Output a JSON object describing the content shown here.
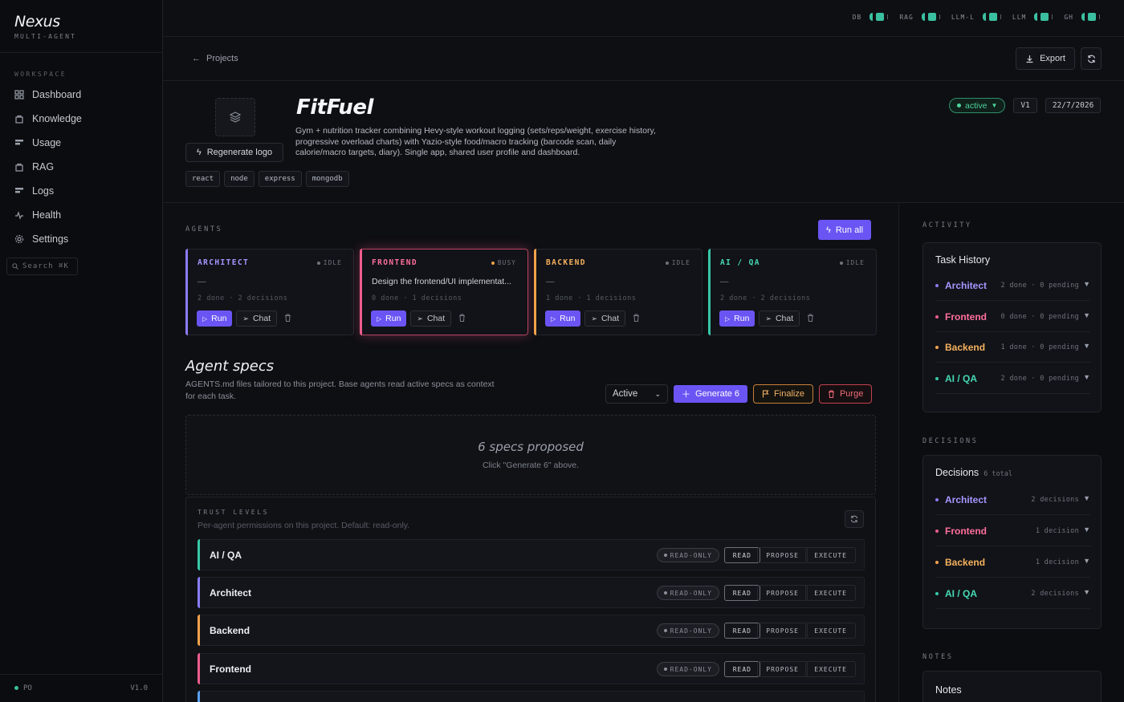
{
  "brand": {
    "name": "Nexus",
    "sub": "MULTI-AGENT"
  },
  "sidebar": {
    "workspace_label": "WORKSPACE",
    "items": [
      {
        "label": "Dashboard"
      },
      {
        "label": "Knowledge"
      },
      {
        "label": "Usage"
      },
      {
        "label": "RAG"
      },
      {
        "label": "Logs"
      },
      {
        "label": "Health"
      },
      {
        "label": "Settings"
      }
    ],
    "search_label": "Search ⌘K",
    "footer_left": "PO",
    "footer_right": "V1.0"
  },
  "status": [
    {
      "label": "DB"
    },
    {
      "label": "RAG"
    },
    {
      "label": "LLM-L"
    },
    {
      "label": "LLM"
    },
    {
      "label": "GH"
    }
  ],
  "breadcrumb": {
    "label": "Projects"
  },
  "toolbar": {
    "export_label": "Export"
  },
  "project": {
    "title": "FitFuel",
    "description": "Gym + nutrition tracker combining Hevy-style workout logging (sets/reps/weight, exercise history, progressive overload charts) with Yazio-style food/macro tracking (barcode scan, daily calorie/macro targets, diary). Single app, shared user profile and dashboard.",
    "regen_label": "Regenerate logo",
    "tags": [
      "react",
      "node",
      "express",
      "mongodb"
    ],
    "status": "active",
    "version": "V1",
    "date": "22/7/2026"
  },
  "agents_section": {
    "label": "AGENTS",
    "run_all": "Run all"
  },
  "agents": [
    {
      "name": "ARCHITECT",
      "state": "IDLE",
      "task": "—",
      "meta": "2 done · 2 decisions",
      "color": "#8a7cf6"
    },
    {
      "name": "FRONTEND",
      "state": "BUSY",
      "task": "Design the frontend/UI implementat...",
      "meta": "0 done · 1 decisions",
      "color": "#ee5d8c"
    },
    {
      "name": "BACKEND",
      "state": "IDLE",
      "task": "—",
      "meta": "1 done · 1 decisions",
      "color": "#f3a24b"
    },
    {
      "name": "AI / QA",
      "state": "IDLE",
      "task": "—",
      "meta": "2 done · 2 decisions",
      "color": "#37c8a6"
    }
  ],
  "agent_buttons": {
    "run": "Run",
    "chat": "Chat"
  },
  "specs": {
    "title": "Agent specs",
    "desc": "AGENTS.md files tailored to this project. Base agents read active specs as context for each task.",
    "filter": "Active",
    "generate": "Generate 6",
    "finalize": "Finalize",
    "purge": "Purge",
    "proposed_title": "6 specs proposed",
    "proposed_sub": "Click \"Generate 6\" above."
  },
  "trust": {
    "label": "TRUST LEVELS",
    "desc": "Per-agent permissions on this project. Default: read-only.",
    "pill": "READ-ONLY",
    "perms": [
      "READ",
      "PROPOSE",
      "EXECUTE"
    ],
    "rows": [
      {
        "name": "AI / QA",
        "color": "#37c8a6"
      },
      {
        "name": "Architect",
        "color": "#8a7cf6"
      },
      {
        "name": "Backend",
        "color": "#f3a24b"
      },
      {
        "name": "Frontend",
        "color": "#ee5d8c"
      }
    ]
  },
  "activity": {
    "label": "ACTIVITY",
    "title": "Task History",
    "rows": [
      {
        "name": "Architect",
        "meta": "2 done · 0 pending",
        "color": "#8a7cf6"
      },
      {
        "name": "Frontend",
        "meta": "0 done · 0 pending",
        "color": "#ee5d8c"
      },
      {
        "name": "Backend",
        "meta": "1 done · 0 pending",
        "color": "#f3a24b"
      },
      {
        "name": "AI / QA",
        "meta": "2 done · 0 pending",
        "color": "#37c8a6"
      }
    ]
  },
  "decisions": {
    "label": "DECISIONS",
    "title": "Decisions",
    "count": "6 total",
    "rows": [
      {
        "name": "Architect",
        "meta": "2 decisions",
        "color": "#8a7cf6"
      },
      {
        "name": "Frontend",
        "meta": "1 decision",
        "color": "#ee5d8c"
      },
      {
        "name": "Backend",
        "meta": "1 decision",
        "color": "#f3a24b"
      },
      {
        "name": "AI / QA",
        "meta": "2 decisions",
        "color": "#37c8a6"
      }
    ]
  },
  "notes": {
    "label": "NOTES",
    "title": "Notes"
  }
}
